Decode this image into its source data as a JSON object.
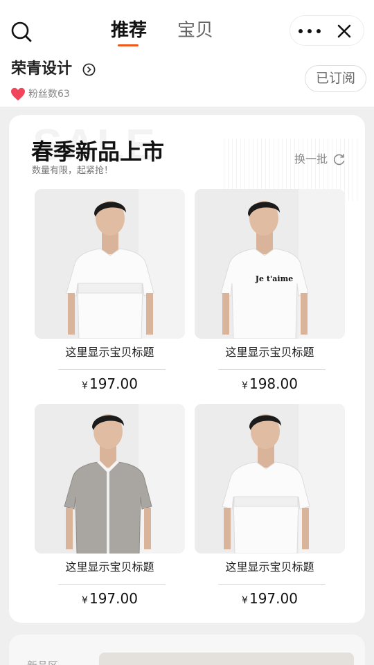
{
  "nav": {
    "tabs": [
      {
        "label": "推荐",
        "active": true
      },
      {
        "label": "宝贝",
        "active": false
      }
    ],
    "icons": {
      "search": "search-icon",
      "more": "more-icon",
      "close": "close-icon"
    },
    "accent": "#ef5a1c"
  },
  "shop": {
    "name": "荣青设计",
    "fans": "粉丝数63",
    "subscribe_label": "已订阅"
  },
  "promo": {
    "watermark": "SALE",
    "title": "春季新品上市",
    "subtitle": "数量有限，起紧抢！",
    "refresh_label": "换一批",
    "products": [
      {
        "title": "这里显示宝贝标题",
        "currency": "¥",
        "price": "197.00",
        "shirt": "white-tee"
      },
      {
        "title": "这里显示宝贝标题",
        "currency": "¥",
        "price": "198.00",
        "shirt": "white-tee-print",
        "print_text": "Je t'aime"
      },
      {
        "title": "这里显示宝贝标题",
        "currency": "¥",
        "price": "197.00",
        "shirt": "grey-polo"
      },
      {
        "title": "这里显示宝贝标题",
        "currency": "¥",
        "price": "197.00",
        "shirt": "white-tee"
      }
    ]
  },
  "next_section": {
    "label": "新品区"
  }
}
